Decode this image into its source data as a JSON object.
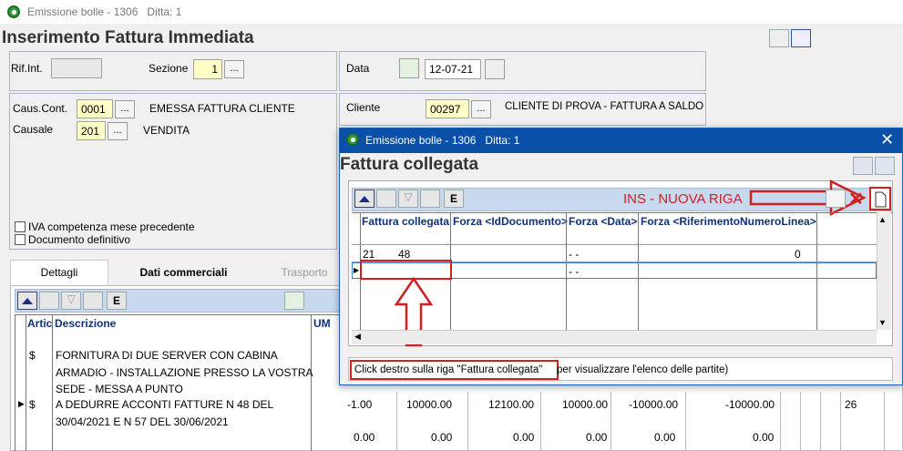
{
  "window": {
    "title": "Emissione bolle - 1306",
    "ditta": "Ditta: 1"
  },
  "page": {
    "title": "Inserimento Fattura Immediata"
  },
  "header": {
    "rif_label": "Rif.Int.",
    "sezione_label": "Sezione",
    "sezione_value": "1",
    "data_label": "Data",
    "data_value": "12-07-21",
    "caus_cont_label": "Caus.Cont.",
    "caus_cont_code": "0001",
    "caus_cont_desc": "EMESSA FATTURA CLIENTE",
    "causale_label": "Causale",
    "causale_code": "201",
    "causale_desc": "VENDITA",
    "cliente_label": "Cliente",
    "cliente_code": "00297",
    "cliente_desc": "CLIENTE DI PROVA - FATTURA A SALDO",
    "iva_check": "IVA competenza mese precedente",
    "doc_check": "Documento definitivo",
    "dots": "..."
  },
  "tabs": [
    {
      "label": "Dettagli"
    },
    {
      "label": "Dati commerciali"
    },
    {
      "label": "Trasporto"
    }
  ],
  "grid": {
    "headers": {
      "artic": "Artic",
      "descr": "Descrizione",
      "um": "UM"
    },
    "rows": [
      {
        "artic": "$",
        "descr1": "FORNITURA DI DUE SERVER CON CABINA",
        "descr2": "ARMADIO - INSTALLAZIONE PRESSO LA VOSTRA",
        "descr3": "SEDE - MESSA A PUNTO"
      },
      {
        "artic": "$",
        "descr1": "A DEDURRE ACCONTI FATTURE N 48 DEL",
        "descr2": "30/04/2021 E N 57 DEL 30/06/2021",
        "v1": "-1.00",
        "v2": "10000.00",
        "v3": "12100.00",
        "v4": "10000.00",
        "v5": "-10000.00",
        "v6": "-10000.00",
        "v7": "26"
      },
      {
        "v1": "0.00",
        "v2": "0.00",
        "v3": "0.00",
        "v4": "0.00",
        "v5": "0.00",
        "v6": "0.00"
      }
    ]
  },
  "dialog": {
    "title": "Emissione bolle - 1306",
    "ditta": "Ditta: 1",
    "heading": "Fattura collegata",
    "annotation": "INS - NUOVA RIGA",
    "columns": [
      "Fattura collegata",
      "Forza <IdDocumento>",
      "Forza <Data>",
      "Forza <RiferimentoNumeroLinea>"
    ],
    "rows": [
      {
        "c1a": "21",
        "c1b": "48",
        "c3": "- -",
        "c4": "0"
      },
      {
        "c3": "- -"
      }
    ],
    "hint": "Click destro sulla riga \"Fattura collegata\" per visualizzare l'elenco delle partite",
    "hint_a": "Click destro sulla riga \"Fattura collegata\"",
    "hint_b": " per visualizzare l'elenco delle partite)"
  },
  "colors": {
    "accent_red": "#d02020",
    "dialog_title": "#0a4fa8",
    "label_blue": "#103080"
  }
}
